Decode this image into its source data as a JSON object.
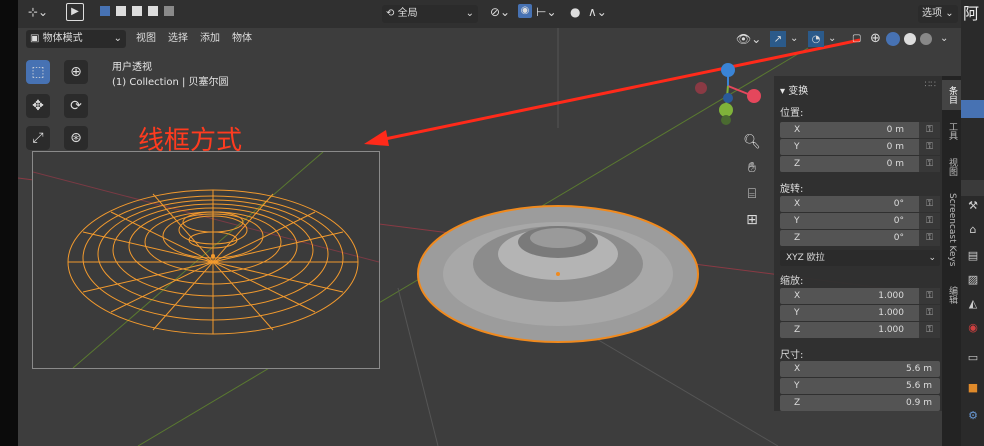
{
  "header": {
    "orientation_label": "全局",
    "options_label": "选项",
    "extra_chars": "阿"
  },
  "viewport_header": {
    "mode_label": "物体模式",
    "menus": [
      "视图",
      "选择",
      "添加",
      "物体"
    ]
  },
  "overlay": {
    "view_name": "用户透视",
    "collection_text": "(1) Collection | 贝塞尔圆"
  },
  "annotation": {
    "text": "线框方式",
    "color": "#ff3b1f"
  },
  "transform_panel": {
    "title": "变换",
    "location_label": "位置:",
    "location": [
      {
        "axis": "X",
        "value": "0 m"
      },
      {
        "axis": "Y",
        "value": "0 m"
      },
      {
        "axis": "Z",
        "value": "0 m"
      }
    ],
    "rotation_label": "旋转:",
    "rotation": [
      {
        "axis": "X",
        "value": "0°"
      },
      {
        "axis": "Y",
        "value": "0°"
      },
      {
        "axis": "Z",
        "value": "0°"
      }
    ],
    "rotation_mode": "XYZ 欧拉",
    "scale_label": "缩放:",
    "scale": [
      {
        "axis": "X",
        "value": "1.000"
      },
      {
        "axis": "Y",
        "value": "1.000"
      },
      {
        "axis": "Z",
        "value": "1.000"
      }
    ],
    "dimensions_label": "尺寸:",
    "dimensions": [
      {
        "axis": "X",
        "value": "5.6 m"
      },
      {
        "axis": "Y",
        "value": "5.6 m"
      },
      {
        "axis": "Z",
        "value": "0.9 m"
      }
    ]
  },
  "side_tabs": [
    "条目",
    "工具",
    "视图",
    "Screencast Keys",
    "编辑"
  ],
  "colors": {
    "accent": "#4772b3",
    "wireframe": "#f29a2e",
    "selection_outline": "#f08a1e",
    "axis_x": "#e5475c",
    "axis_y": "#7fb23a",
    "axis_z": "#3a84d6",
    "arrow": "#ff2a1a"
  }
}
